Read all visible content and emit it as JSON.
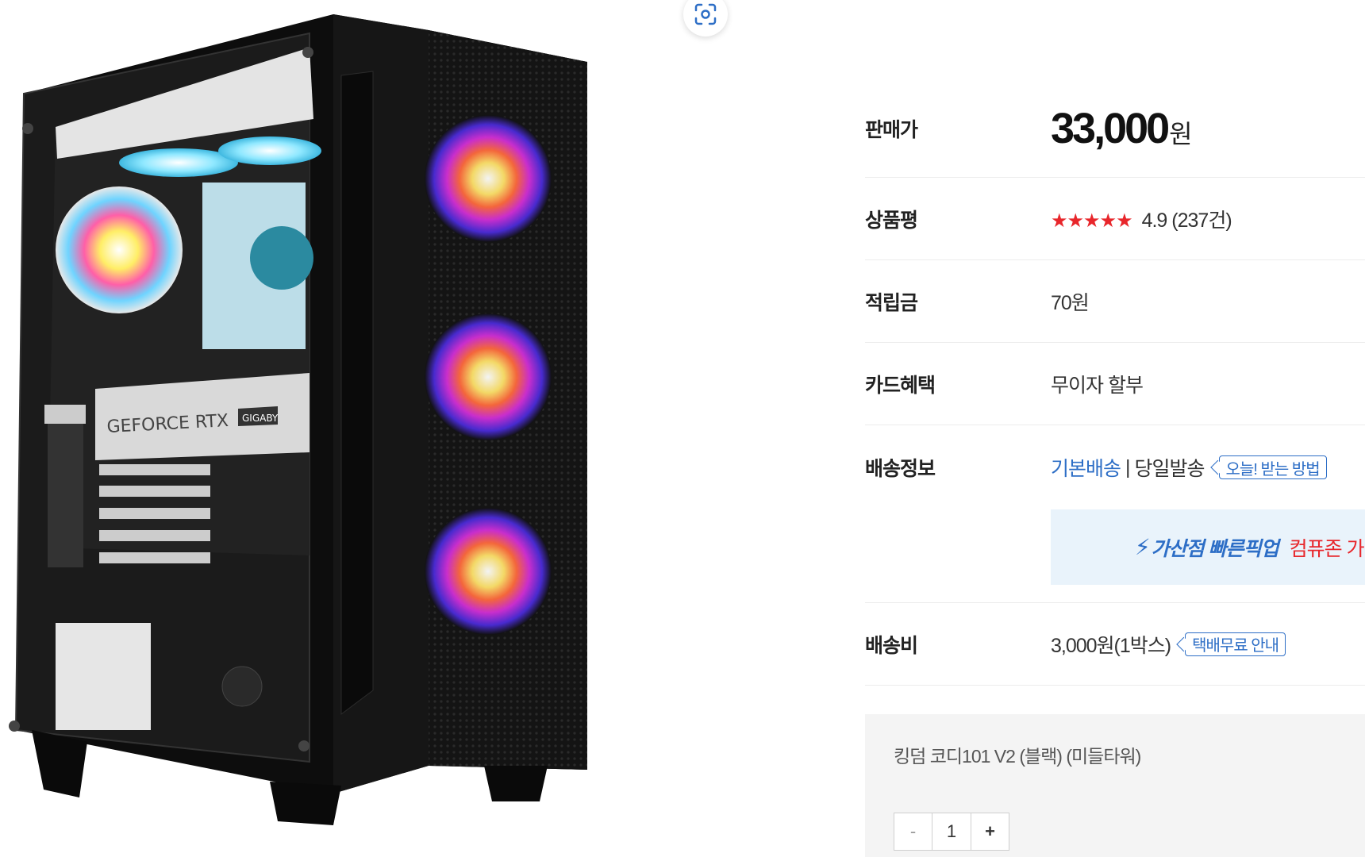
{
  "lens": {
    "icon": "scan-icon"
  },
  "product": {
    "image_alt": "GEFORCE RTX GIGABY"
  },
  "price": {
    "label": "판매가",
    "amount": "33,000",
    "unit": "원"
  },
  "review": {
    "label": "상품평",
    "stars": "★★★★★",
    "rating": 4.9,
    "score_text": "4.9 (237건)"
  },
  "points": {
    "label": "적립금",
    "value": "70원"
  },
  "card": {
    "label": "카드혜택",
    "value": "무이자 할부"
  },
  "shipping": {
    "label": "배송정보",
    "basic": "기본배송",
    "separator": "|",
    "same_day": "당일발송",
    "today_link": "오늘! 받는 방법",
    "pickup_icon": "lightning-icon",
    "pickup_name": "가산점 빠른픽업",
    "pickup_desc": "컴퓨존 가"
  },
  "fee": {
    "label": "배송비",
    "value": "3,000원(1박스)",
    "free_link": "택배무료 안내"
  },
  "option": {
    "name": "킹덤 코디101 V2 (블랙) (미들타워)",
    "qty_minus": "-",
    "qty_value": "1",
    "qty_plus": "+"
  },
  "colors": {
    "accent_blue": "#2d6ec6",
    "star_red": "#e8262b",
    "banner_bg": "#e9f3fb"
  }
}
